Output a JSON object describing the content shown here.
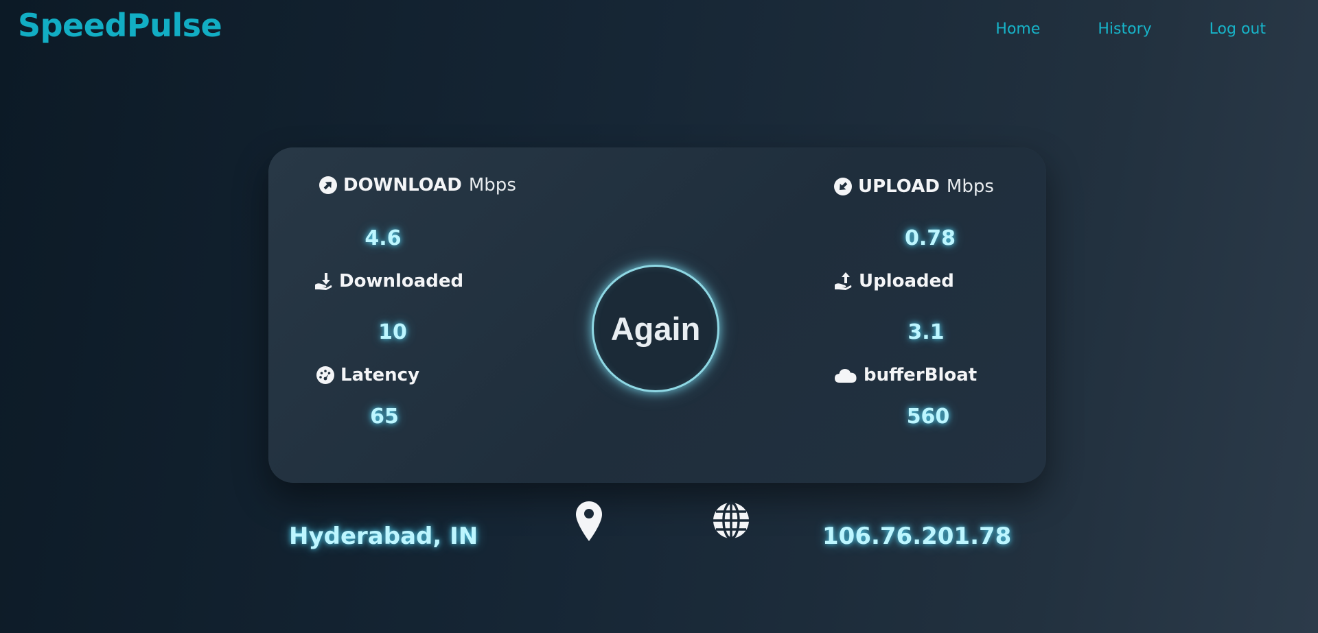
{
  "brand": "SpeedPulse",
  "nav": {
    "home": "Home",
    "history": "History",
    "logout": "Log out"
  },
  "metrics": {
    "download": {
      "label": "DOWNLOAD",
      "unit": "Mbps",
      "value": "4.6",
      "icon": "arrow-circle-icon"
    },
    "upload": {
      "label": "UPLOAD",
      "unit": "Mbps",
      "value": "0.78",
      "icon": "arrow-circle-icon"
    },
    "downloaded": {
      "label": "Downloaded",
      "value": "10",
      "icon": "hand-down-icon"
    },
    "uploaded": {
      "label": "Uploaded",
      "value": "3.1",
      "icon": "hand-up-icon"
    },
    "latency": {
      "label": "Latency",
      "value": "65",
      "icon": "gauge-icon"
    },
    "bufferbloat": {
      "label": "bufferBloat",
      "value": "560",
      "icon": "cloud-icon"
    }
  },
  "action": {
    "label": "Again"
  },
  "footer": {
    "location": "Hyderabad, IN",
    "ip": "106.76.201.78"
  },
  "colors": {
    "accent": "#12aec4",
    "value_glow": "#bdf6ff"
  }
}
